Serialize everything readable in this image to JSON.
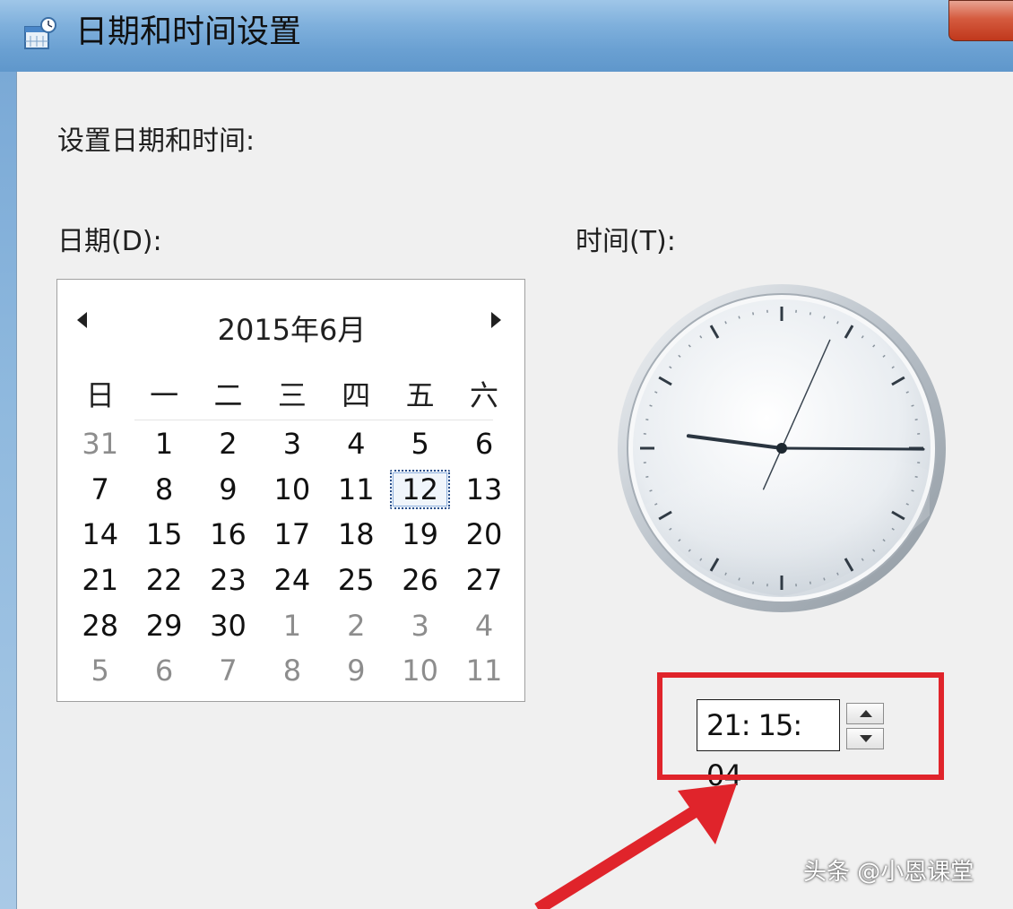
{
  "window": {
    "title": "日期和时间设置",
    "icon": "calendar-clock-icon"
  },
  "heading": "设置日期和时间:",
  "date_section": {
    "label": "日期(D):",
    "calendar": {
      "month_title": "2015年6月",
      "prev_icon": "triangle-left-icon",
      "next_icon": "triangle-right-icon",
      "weekdays": [
        "日",
        "一",
        "二",
        "三",
        "四",
        "五",
        "六"
      ],
      "selected_day": "12",
      "weeks": [
        [
          {
            "d": "31",
            "other": true
          },
          {
            "d": "1"
          },
          {
            "d": "2"
          },
          {
            "d": "3"
          },
          {
            "d": "4"
          },
          {
            "d": "5"
          },
          {
            "d": "6"
          }
        ],
        [
          {
            "d": "7"
          },
          {
            "d": "8"
          },
          {
            "d": "9"
          },
          {
            "d": "10"
          },
          {
            "d": "11"
          },
          {
            "d": "12",
            "selected": true
          },
          {
            "d": "13"
          }
        ],
        [
          {
            "d": "14"
          },
          {
            "d": "15"
          },
          {
            "d": "16"
          },
          {
            "d": "17"
          },
          {
            "d": "18"
          },
          {
            "d": "19"
          },
          {
            "d": "20"
          }
        ],
        [
          {
            "d": "21"
          },
          {
            "d": "22"
          },
          {
            "d": "23"
          },
          {
            "d": "24"
          },
          {
            "d": "25"
          },
          {
            "d": "26"
          },
          {
            "d": "27"
          }
        ],
        [
          {
            "d": "28"
          },
          {
            "d": "29"
          },
          {
            "d": "30"
          },
          {
            "d": "1",
            "other": true
          },
          {
            "d": "2",
            "other": true
          },
          {
            "d": "3",
            "other": true
          },
          {
            "d": "4",
            "other": true
          }
        ],
        [
          {
            "d": "5",
            "other": true
          },
          {
            "d": "6",
            "other": true
          },
          {
            "d": "7",
            "other": true
          },
          {
            "d": "8",
            "other": true
          },
          {
            "d": "9",
            "other": true
          },
          {
            "d": "10",
            "other": true
          },
          {
            "d": "11",
            "other": true
          }
        ]
      ]
    }
  },
  "time_section": {
    "label": "时间(T):",
    "clock": {
      "hour": 21,
      "minute": 15,
      "second": 4
    },
    "time_value": "21: 15: 04",
    "spinner_up_icon": "spin-up-icon",
    "spinner_down_icon": "spin-down-icon"
  },
  "annotation": {
    "highlight_color": "#e0242b",
    "arrow_icon": "red-arrow-icon"
  },
  "watermark": "头条 @小恩课堂"
}
